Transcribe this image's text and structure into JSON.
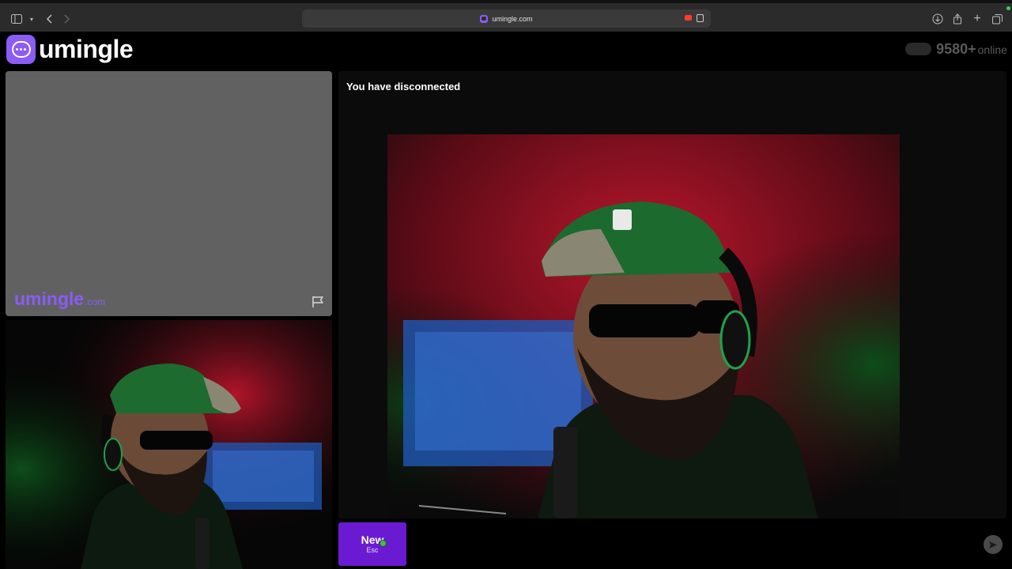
{
  "browser": {
    "url": "umingle.com"
  },
  "header": {
    "logo_text": "umingle",
    "online_count": "9580+",
    "online_label": "online"
  },
  "self_panel": {
    "watermark_main": "umingle",
    "watermark_tld": ".com"
  },
  "chat": {
    "status": "You have disconnected"
  },
  "controls": {
    "new_label": "New",
    "new_shortcut": "Esc"
  },
  "colors": {
    "brand": "#8b5cf6",
    "new_button": "#6a1bd1"
  }
}
